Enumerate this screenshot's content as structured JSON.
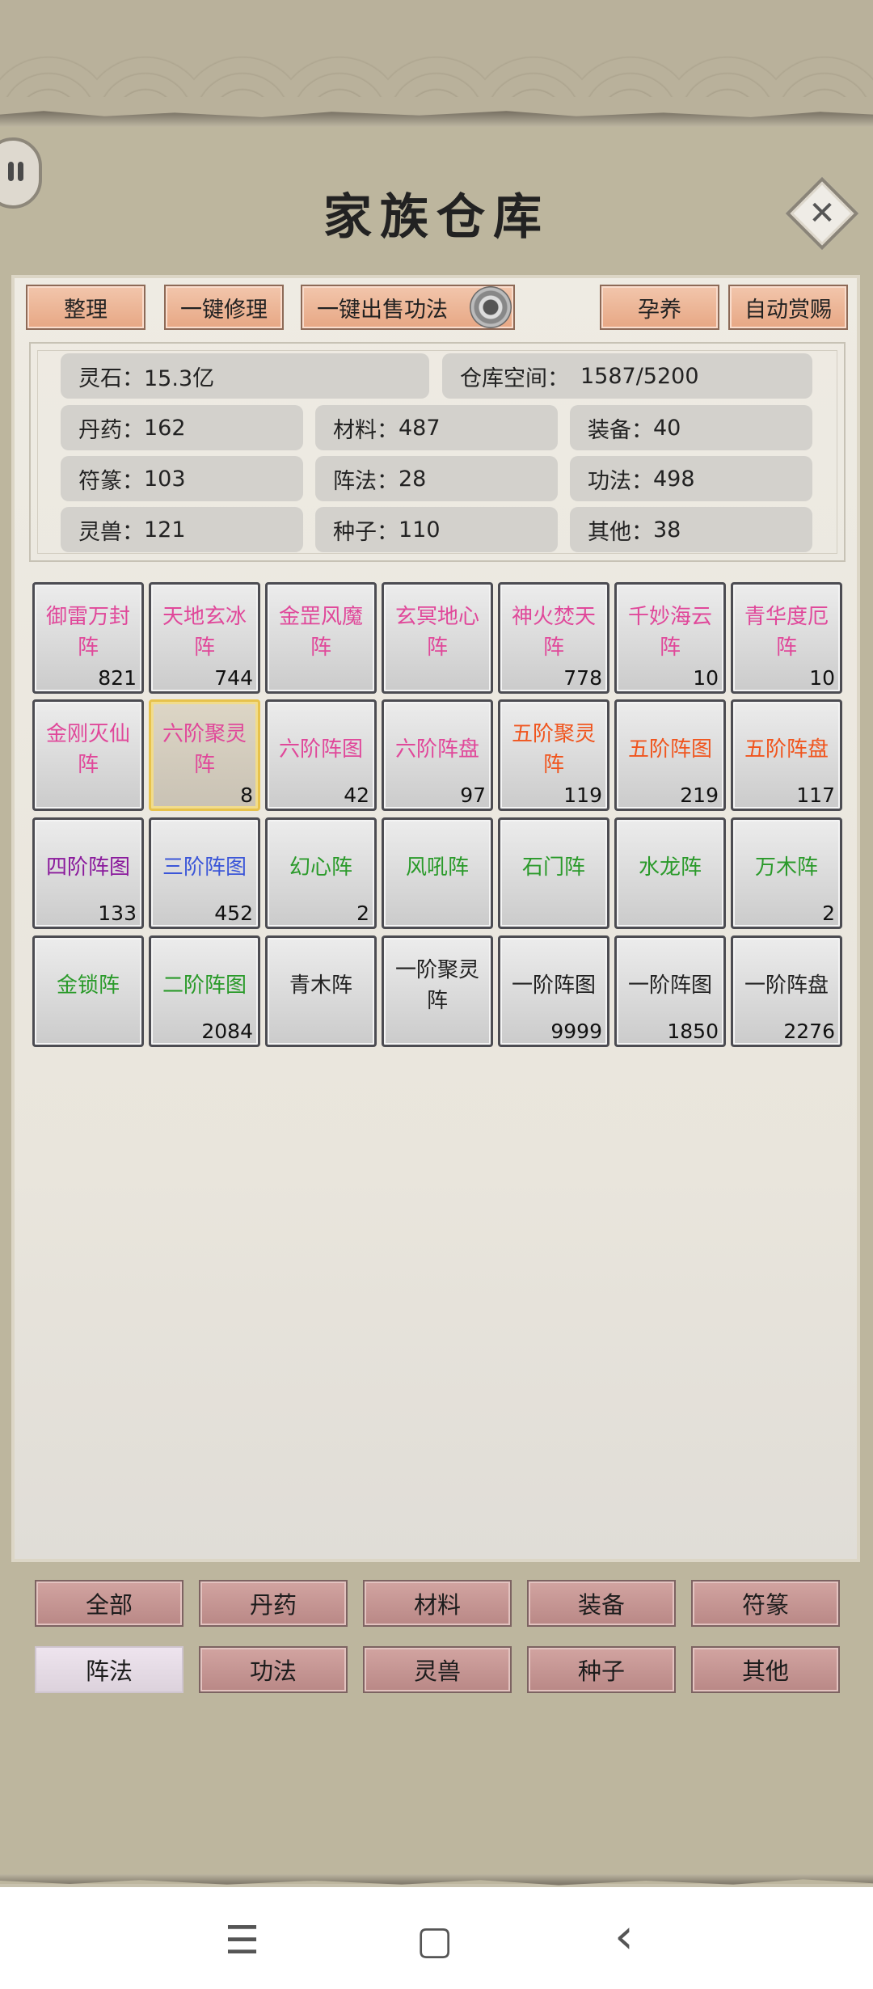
{
  "title": "家族仓库",
  "toolbar": {
    "sort": "整理",
    "repair_all": "一键修理",
    "sell_skills": "一键出售功法",
    "nurture": "孕养",
    "auto_reward": "自动赏赐"
  },
  "stats": {
    "spirit_stone": {
      "label": "灵石：",
      "value": "15.3亿"
    },
    "capacity": {
      "label": "仓库空间：",
      "value": "1587/5200"
    },
    "pill": {
      "label": "丹药：",
      "value": "162"
    },
    "material": {
      "label": "材料：",
      "value": "487"
    },
    "equipment": {
      "label": "装备：",
      "value": "40"
    },
    "talisman": {
      "label": "符篆：",
      "value": "103"
    },
    "formation": {
      "label": "阵法：",
      "value": "28"
    },
    "skill": {
      "label": "功法：",
      "value": "498"
    },
    "beast": {
      "label": "灵兽：",
      "value": "121"
    },
    "seed": {
      "label": "种子：",
      "value": "110"
    },
    "other": {
      "label": "其他：",
      "value": "38"
    }
  },
  "items": [
    {
      "name": "御雷万封阵",
      "count": "821",
      "color": "#e0489a"
    },
    {
      "name": "天地玄冰阵",
      "count": "744",
      "color": "#e0489a"
    },
    {
      "name": "金罡风魔阵",
      "count": "",
      "color": "#e0489a"
    },
    {
      "name": "玄冥地心阵",
      "count": "",
      "color": "#e0489a"
    },
    {
      "name": "神火焚天阵",
      "count": "778",
      "color": "#e0489a"
    },
    {
      "name": "千妙海云阵",
      "count": "10",
      "color": "#e0489a"
    },
    {
      "name": "青华度厄阵",
      "count": "10",
      "color": "#e0489a"
    },
    {
      "name": "金刚灭仙阵",
      "count": "",
      "color": "#e0489a"
    },
    {
      "name": "六阶聚灵阵",
      "count": "8",
      "color": "#e0489a"
    },
    {
      "name": "六阶阵图",
      "count": "42",
      "color": "#e0489a"
    },
    {
      "name": "六阶阵盘",
      "count": "97",
      "color": "#e0489a"
    },
    {
      "name": "五阶聚灵阵",
      "count": "119",
      "color": "#f0551e"
    },
    {
      "name": "五阶阵图",
      "count": "219",
      "color": "#f0551e"
    },
    {
      "name": "五阶阵盘",
      "count": "117",
      "color": "#f0551e"
    },
    {
      "name": "四阶阵图",
      "count": "133",
      "color": "#8a1a9c"
    },
    {
      "name": "三阶阵图",
      "count": "452",
      "color": "#3b56d8"
    },
    {
      "name": "幻心阵",
      "count": "2",
      "color": "#2a9a2a"
    },
    {
      "name": "风吼阵",
      "count": "",
      "color": "#2a9a2a"
    },
    {
      "name": "石门阵",
      "count": "",
      "color": "#2a9a2a"
    },
    {
      "name": "水龙阵",
      "count": "",
      "color": "#2a9a2a"
    },
    {
      "name": "万木阵",
      "count": "2",
      "color": "#2a9a2a"
    },
    {
      "name": "金锁阵",
      "count": "",
      "color": "#2a9a2a"
    },
    {
      "name": "二阶阵图",
      "count": "2084",
      "color": "#2a9a2a"
    },
    {
      "name": "青木阵",
      "count": "",
      "color": "#222222"
    },
    {
      "name": "一阶聚灵阵",
      "count": "",
      "color": "#222222"
    },
    {
      "name": "一阶阵图",
      "count": "9999",
      "color": "#222222"
    },
    {
      "name": "一阶阵图",
      "count": "1850",
      "color": "#222222"
    },
    {
      "name": "一阶阵盘",
      "count": "2276",
      "color": "#222222"
    }
  ],
  "selected_item": "六阶聚灵阵",
  "categories": [
    "全部",
    "丹药",
    "材料",
    "装备",
    "符篆",
    "阵法",
    "功法",
    "灵兽",
    "种子",
    "其他"
  ],
  "active_category": "阵法",
  "nav": {
    "menu": "☰",
    "home": "▢",
    "back": "‹"
  },
  "icons": [
    "pause-icon",
    "close-icon",
    "gear-icon",
    "menu-icon",
    "home-icon",
    "back-icon"
  ]
}
